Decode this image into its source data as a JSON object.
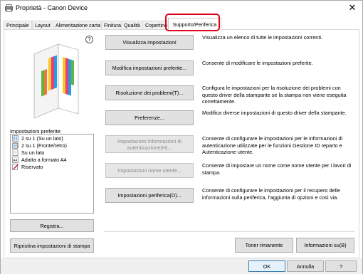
{
  "window": {
    "title": "Proprietà - Canon Device",
    "close_glyph": "✕"
  },
  "tabs": [
    {
      "label": "Principale"
    },
    {
      "label": "Layout"
    },
    {
      "label": "Alimentazione carta"
    },
    {
      "label": "Finitura"
    },
    {
      "label": "Qualità"
    },
    {
      "label": "Copertine"
    },
    {
      "label": "Supporto/Periferica",
      "active": true
    }
  ],
  "help_glyph": "?",
  "preferences": {
    "label": "Impostazioni preferite:",
    "items": [
      {
        "label": "2 su 1 (Su un lato)",
        "icon": "doc-2on1-icon"
      },
      {
        "label": "2 su 1 (Fronte/retro)",
        "icon": "doc-2on1-duplex-icon"
      },
      {
        "label": "Su un lato",
        "icon": "doc-single-icon"
      },
      {
        "label": "Adatta a formato A4",
        "icon": "fit-a4-icon"
      },
      {
        "label": "Riservato",
        "icon": "confidential-pen-icon"
      }
    ]
  },
  "left_buttons": {
    "register": "Registra...",
    "restore": "Ripristina impostazioni di stampa"
  },
  "actions": [
    {
      "label": "Visualizza impostazioni",
      "desc": "Visualizza un elenco di tutte le impostazioni correnti.",
      "disabled": false
    },
    {
      "label": "Modifica impostazioni preferite...",
      "desc": "Consente di modificare le impostazioni preferite.",
      "disabled": false
    },
    {
      "label": "Risoluzione dei problemi(T)...",
      "desc": "Configura le impostazioni per la risoluzione dei problemi con questo driver della stampante se la stampa non viene eseguita correttamente.",
      "disabled": false
    },
    {
      "label": "Preferenze...",
      "desc": "Modifica diverse impostazioni di questo driver della stampante.",
      "disabled": false
    },
    {
      "label": "Impostazioni informazioni di autenticazione(H)...",
      "desc": "Consente di configurare le impostazioni per le informazioni di autenticazione utilizzate per le funzioni Gestione ID reparto e Autenticazione utente.",
      "disabled": true
    },
    {
      "label": "Impostazioni nome utente...",
      "desc": "Consente di impostare un nome come nome utente per i lavori di stampa.",
      "disabled": true
    },
    {
      "label": "Impostazioni periferica(D)...",
      "desc": "Consente di configurare le impostazioni per il recupero delle informazioni sulla periferica, l'aggiunta di opzioni e così via.",
      "disabled": false
    }
  ],
  "bottom_buttons": {
    "toner": "Toner rimanente",
    "about": "Informazioni su(B)"
  },
  "footer": {
    "ok": "OK",
    "cancel": "Annulla",
    "help": "?"
  },
  "colors": {
    "highlight": "#e0001a",
    "button_bg": "#e1e1e1",
    "footer_bg": "#f0f0f0"
  }
}
